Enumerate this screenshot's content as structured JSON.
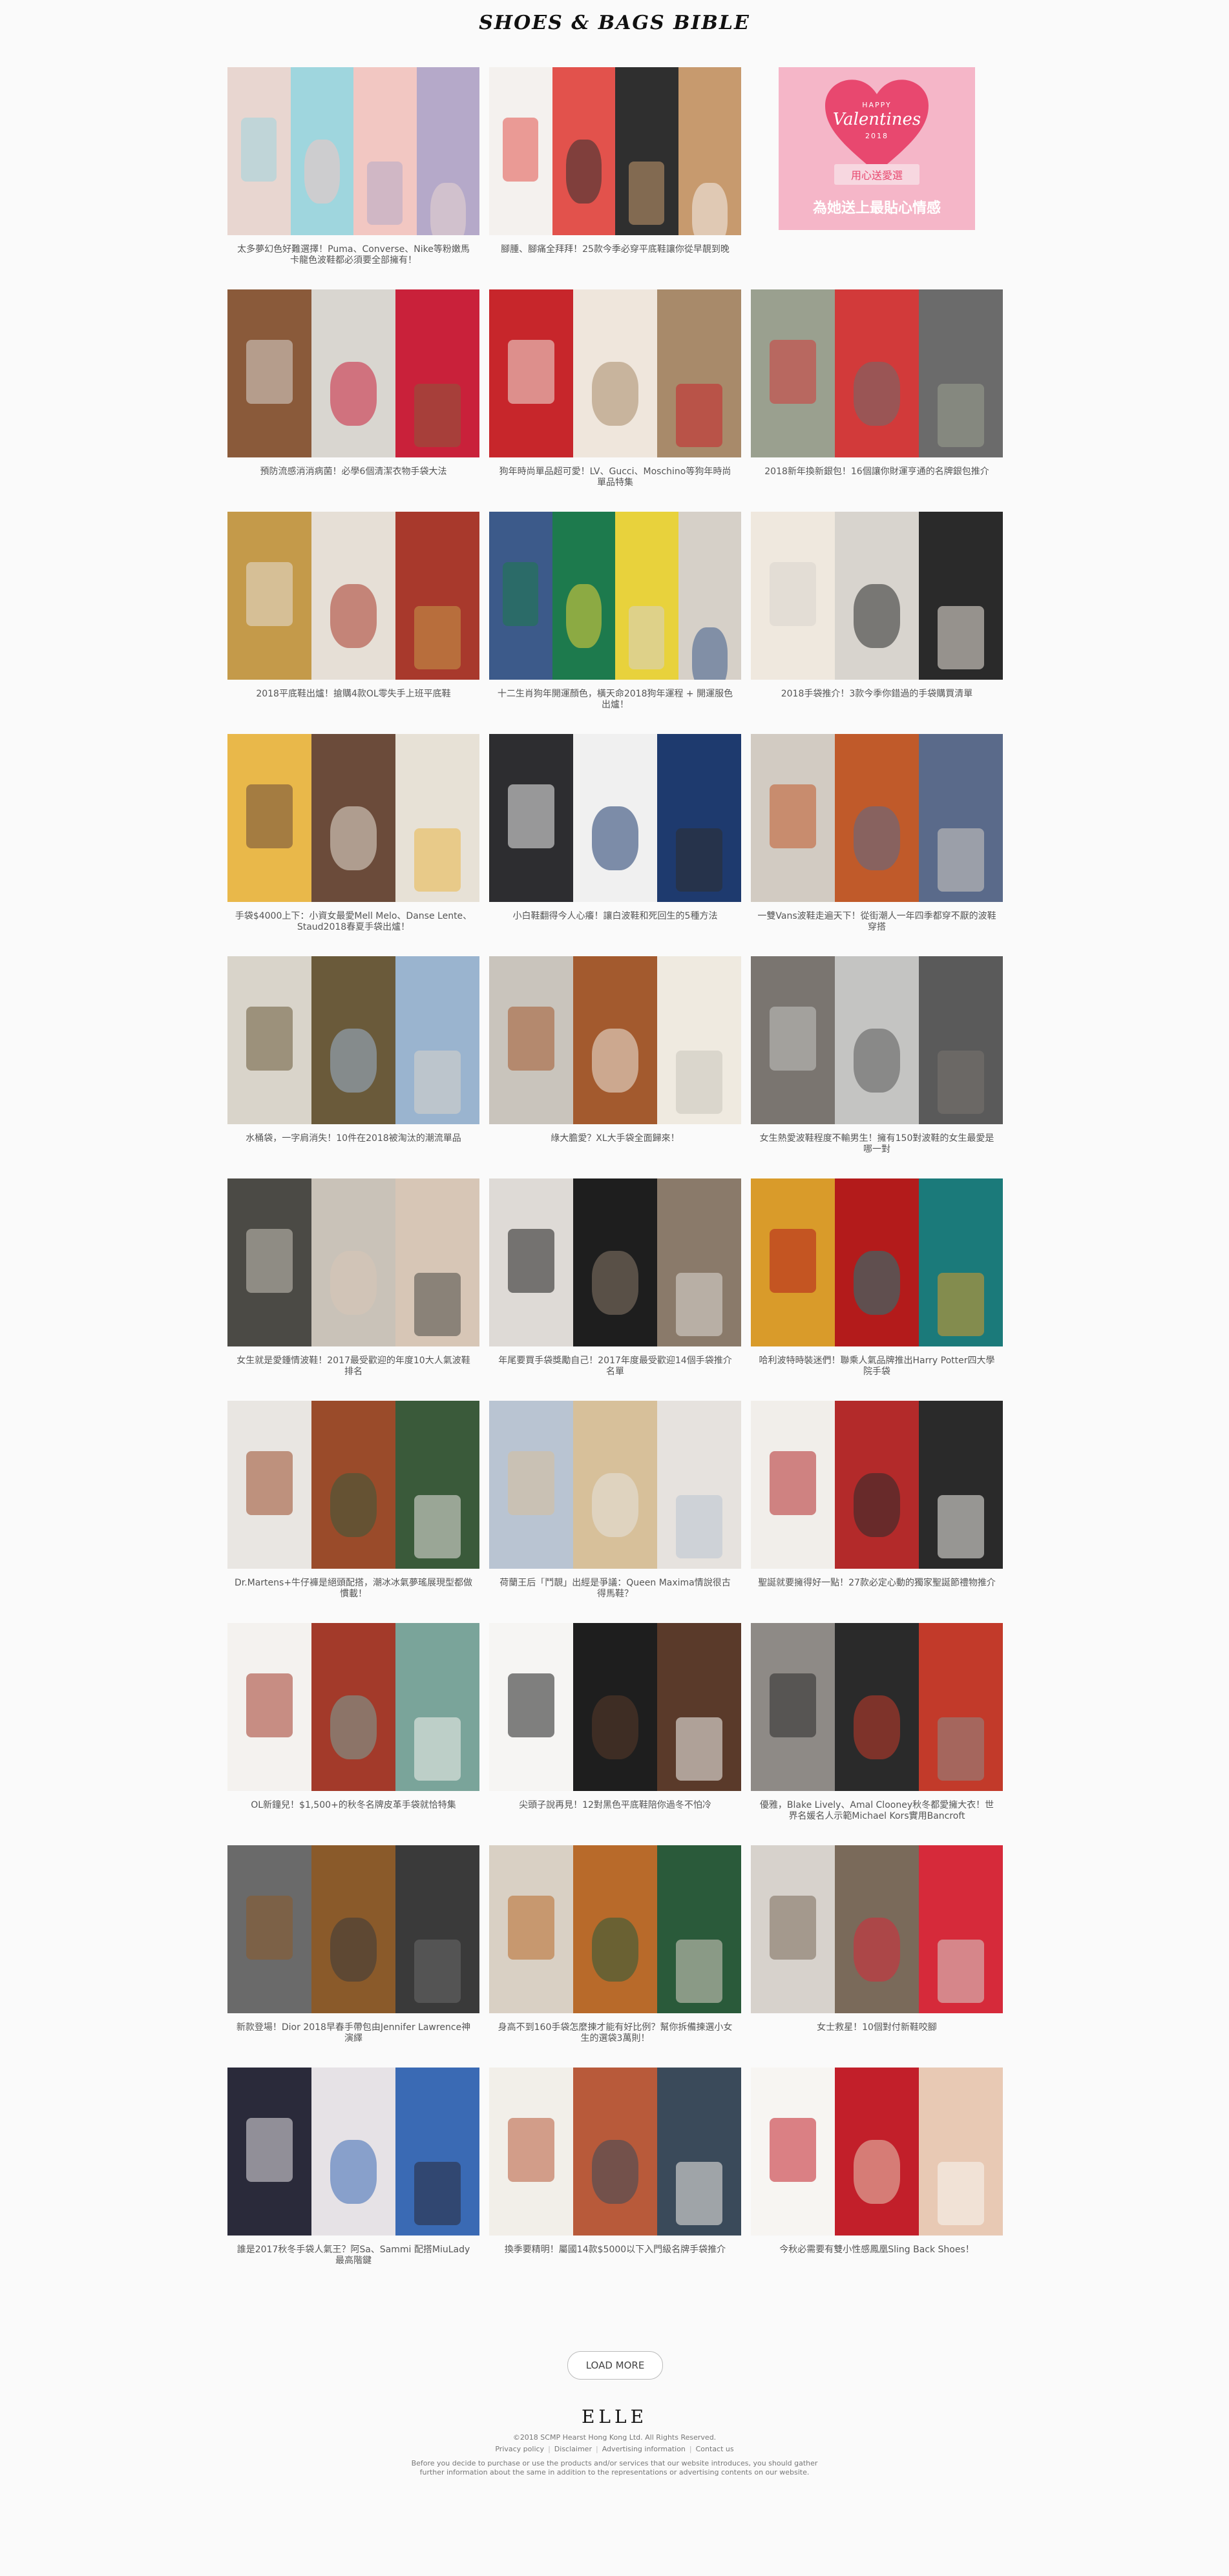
{
  "header": {
    "title": "SHOES & BAGS BIBLE"
  },
  "valentine": {
    "happy": "HAPPY",
    "title": "Valentines",
    "year": "2018",
    "ribbon": "用心送愛選",
    "subtitle": "為她送上最貼心情感"
  },
  "articles": [
    "太多夢幻色好難選擇！Puma、Converse、Nike等粉嫩馬卡龍色波鞋都必須要全部擁有！",
    "腳腫、腳痛全拜拜！25款今季必穿平底鞋讓你從早靚到晚",
    "",
    "預防流感消消病菌！必學6個清潔衣物手袋大法",
    "狗年時尚單品超可愛！LV、Gucci、Moschino等狗年時尚單品特集",
    "2018新年換新銀包！16個讓你財運亨通的名牌銀包推介",
    "2018平底鞋出爐！搶購4款OL零失手上班平底鞋",
    "十二生肖狗年開運顏色，橫天命2018狗年運程 + 開運服色出爐！",
    "2018手袋推介！3款今季你錯過的手袋購買清單",
    "手袋$4000上下：小資女最愛Mell Melo、Danse Lente、Staud2018春夏手袋出爐！",
    "小白鞋翻得今人心癢！讓白波鞋和死回生的5種方法",
    "一雙Vans波鞋走遍天下！從街潮人一年四季都穿不厭的波鞋穿搭",
    "水桶袋，一字肩消失！10件在2018被淘汰的潮流單品",
    "綠大膽愛？XL大手袋全面歸來！",
    "女生熱愛波鞋程度不輸男生！擁有150對波鞋的女生最愛是哪一對",
    "女生就是愛鍾情波鞋！2017最受歡迎的年度10大人氣波鞋排名",
    "年尾要買手袋獎勵自己！2017年度最受歡迎14個手袋推介名單",
    "哈利波特時裝迷們！聯乘人氣品牌推出Harry Potter四大學院手袋",
    "Dr.Martens+牛仔褲是絕頭配搭，潮冰冰氣夢瑤展現型都做慣載！",
    "荷蘭王后「鬥靚」出經是爭議：Queen Maxima情說很古得馬鞋？",
    "聖誕就要擁得好一點！27款必定心動的獨家聖誕節禮物推介",
    "OL新鐘兒！$1,500+的秋冬名牌皮革手袋就恰特集",
    "尖頭子說再見！12對黑色平底鞋陪你過冬不怕冷",
    "優雅，Blake Lively、Amal Clooney秋冬都愛擁大衣！世界名媛名人示範Michael Kors實用Bancroft",
    "新款登場！Dior 2018早春手帶包由Jennifer Lawrence神演繹",
    "身高不到160手袋怎麼揀才能有好比例？幫你拆備揀選小女生的選袋3萬則！",
    "女士救星！10個對付新鞋咬腳",
    "誰是2017秋冬手袋人氣王？阿Sa、Sammi 配搭MiuLady最高階鍵",
    "換季要精明！屬國14款$5000以下入門級名牌手袋推介",
    "今秋必需要有雙小性感鳳凰Sling Back Shoes！"
  ],
  "load_more": "LOAD MORE",
  "footer": {
    "logo": "ELLE",
    "copyright": "©2018 SCMP Hearst Hong Kong Ltd. All Rights Reserved.",
    "links": [
      "Privacy policy",
      "Disclaimer",
      "Advertising information",
      "Contact us"
    ],
    "disclaimer": "Before you decide to purchase or use the products and/or services that our website introduces, you should gather further information about the same in addition to the representations or advertising contents on our website."
  },
  "colors": {
    "background": "#fafafa",
    "text": "#444444",
    "valentine_pink": "#f5b6c8",
    "valentine_heart": "#e8486f"
  }
}
